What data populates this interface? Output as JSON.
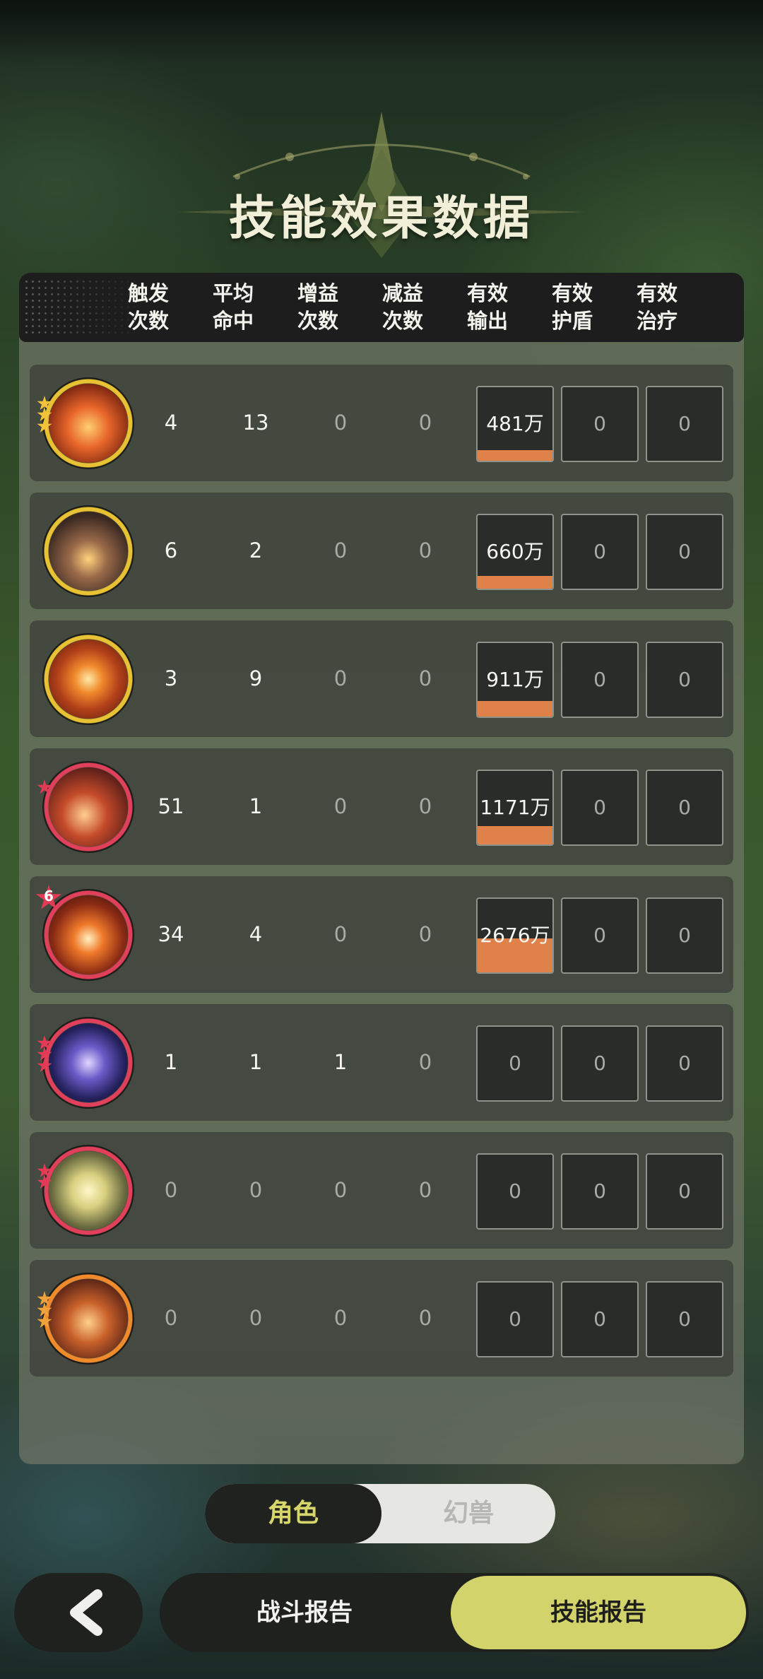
{
  "title": "技能效果数据",
  "columns": [
    "触发\n次数",
    "平均\n命中",
    "增益\n次数",
    "减益\n次数",
    "有效\n输出",
    "有效\n护盾",
    "有效\n治疗"
  ],
  "rows": [
    {
      "icon": "fire-slash-skill-icon",
      "rarity": "gold",
      "stars": 3,
      "trigger": "4",
      "avg_hit": "13",
      "buff": "0",
      "debuff": "0",
      "output": "481万",
      "output_ratio": 0.18,
      "shield": "0",
      "heal": "0"
    },
    {
      "icon": "rock-golem-skill-icon",
      "rarity": "gold",
      "stars": 0,
      "trigger": "6",
      "avg_hit": "2",
      "buff": "0",
      "debuff": "0",
      "output": "660万",
      "output_ratio": 0.25,
      "shield": "0",
      "heal": "0"
    },
    {
      "icon": "fire-vortex-skill-icon",
      "rarity": "gold",
      "stars": 0,
      "trigger": "3",
      "avg_hit": "9",
      "buff": "0",
      "debuff": "0",
      "output": "911万",
      "output_ratio": 0.34,
      "shield": "0",
      "heal": "0"
    },
    {
      "icon": "meteor-skill-icon",
      "rarity": "red",
      "stars": 1,
      "trigger": "51",
      "avg_hit": "1",
      "buff": "0",
      "debuff": "0",
      "output": "1171万",
      "output_ratio": 0.44,
      "shield": "0",
      "heal": "0"
    },
    {
      "icon": "fire-orb-skill-icon",
      "rarity": "red",
      "stars": 0,
      "badge": "6",
      "trigger": "34",
      "avg_hit": "4",
      "buff": "0",
      "debuff": "0",
      "output": "2676万",
      "output_ratio": 1.0,
      "shield": "0",
      "heal": "0"
    },
    {
      "icon": "lightning-orb-skill-icon",
      "rarity": "red",
      "stars": 3,
      "trigger": "1",
      "avg_hit": "1",
      "buff": "1",
      "debuff": "0",
      "output": "0",
      "output_ratio": 0,
      "shield": "0",
      "heal": "0"
    },
    {
      "icon": "rising-arrow-skill-icon",
      "rarity": "red",
      "stars": 2,
      "trigger": "0",
      "avg_hit": "0",
      "buff": "0",
      "debuff": "0",
      "output": "0",
      "output_ratio": 0,
      "shield": "0",
      "heal": "0"
    },
    {
      "icon": "burning-beast-skill-icon",
      "rarity": "orange",
      "stars": 3,
      "trigger": "0",
      "avg_hit": "0",
      "buff": "0",
      "debuff": "0",
      "output": "0",
      "output_ratio": 0,
      "shield": "0",
      "heal": "0"
    }
  ],
  "toggle": {
    "selected": "角色",
    "other": "幻兽"
  },
  "nav": {
    "back_icon": "chevron-left-icon",
    "battle_report": "战斗报告",
    "skill_report": "技能报告",
    "active": "技能报告"
  },
  "colors": {
    "gold_ring": "#e8c233",
    "red_ring": "#e0405a",
    "orange_ring": "#f08a2a",
    "output_bar": "#e0814a",
    "accent": "#d3d36c"
  }
}
